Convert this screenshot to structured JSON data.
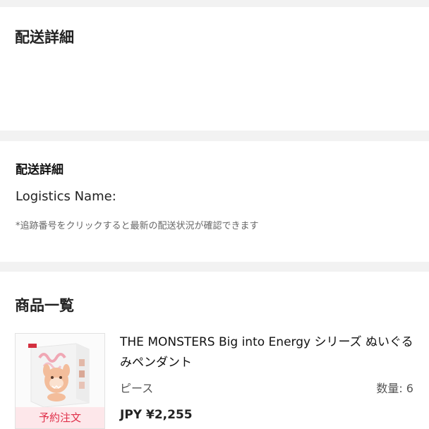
{
  "sections": {
    "delivery_top": {
      "title": "配送詳細"
    },
    "delivery_detail": {
      "title": "配送詳細",
      "logistics_label": "Logistics Name:",
      "hint": "*追跡番号をクリックすると最新の配送状況が確認できます"
    },
    "product_list": {
      "title": "商品一覧",
      "items": [
        {
          "name": "THE MONSTERS Big into Energy シリーズ ぬいぐるみペンダント",
          "unit": "ピース",
          "quantity_label": "数量: 6",
          "price": "JPY ¥2,255",
          "badge": "予約注文",
          "thumbnail_icon": "product-box-image"
        }
      ]
    }
  },
  "colors": {
    "page_bg": "#f2f2f2",
    "card_bg": "#ffffff",
    "badge_bg": "#fde7ea",
    "badge_text": "#e0304a"
  }
}
